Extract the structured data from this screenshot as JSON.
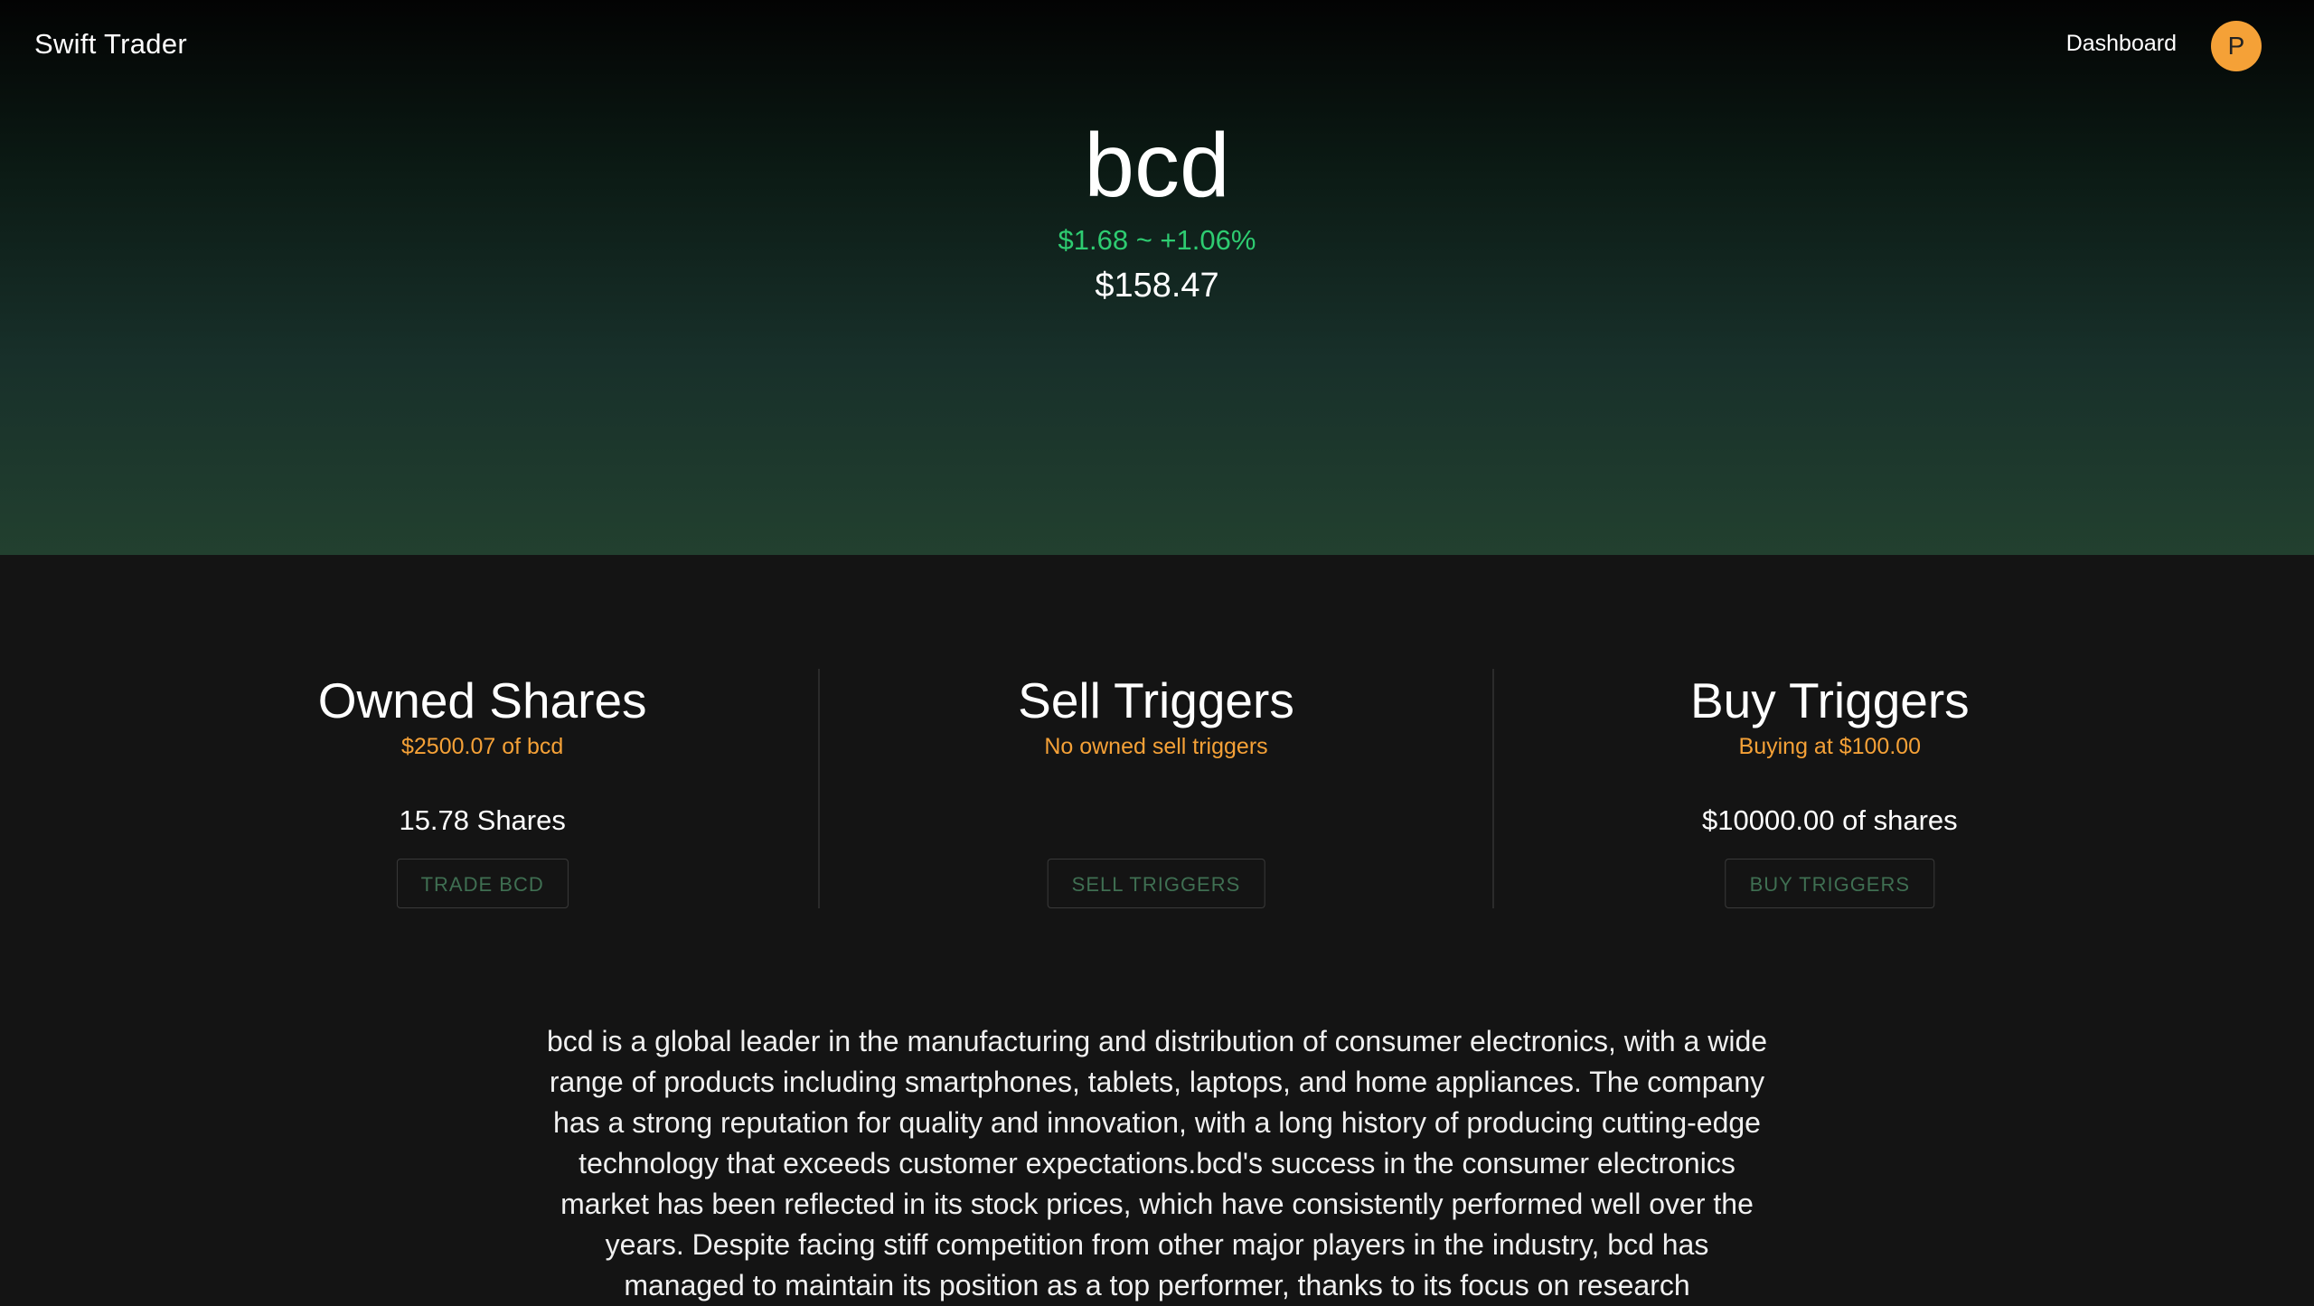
{
  "header": {
    "brand": "Swift Trader",
    "nav_dashboard": "Dashboard",
    "avatar_initial": "P"
  },
  "stock": {
    "ticker": "bcd",
    "change": "$1.68 ~ +1.06%",
    "price": "$158.47"
  },
  "cards": [
    {
      "title": "Owned Shares",
      "subtitle": "$2500.07 of bcd",
      "value": "15.78 Shares",
      "button": "TRADE BCD"
    },
    {
      "title": "Sell Triggers",
      "subtitle": "No owned sell triggers",
      "value": "",
      "button": "SELL TRIGGERS"
    },
    {
      "title": "Buy Triggers",
      "subtitle": "Buying at $100.00",
      "value": "$10000.00 of shares",
      "button": "BUY TRIGGERS"
    }
  ],
  "description": "bcd is a global leader in the manufacturing and distribution of consumer electronics, with a wide range of products including smartphones, tablets, laptops, and home appliances. The company has a strong reputation for quality and innovation, with a long history of producing cutting-edge technology that exceeds customer expectations.bcd's success in the consumer electronics market has been reflected in its stock prices, which have consistently performed well over the years. Despite facing stiff competition from other major players in the industry, bcd has managed to maintain its position as a top performer, thanks to its focus on research",
  "colors": {
    "accent_orange": "#f5a137",
    "positive_green": "#2ecc71",
    "button_text_green": "#3f6f52",
    "background": "#141414"
  }
}
